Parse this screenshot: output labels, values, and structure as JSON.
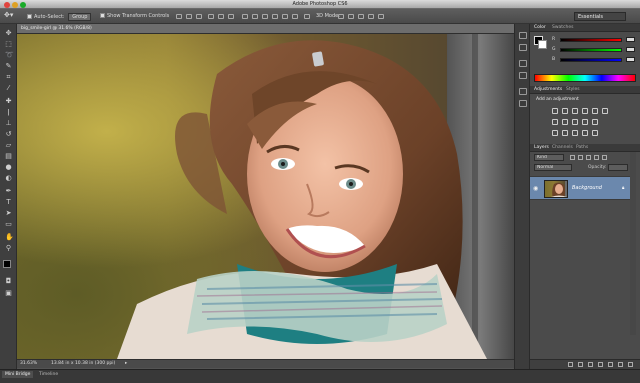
{
  "app": {
    "title": "Adobe Photoshop CS6"
  },
  "options_bar": {
    "auto_select_label": "Auto-Select:",
    "auto_select_value": "Group",
    "transform_controls_label": "Show Transform Controls",
    "mode_3d_label": "3D Mode:",
    "workspace": "Essentials"
  },
  "document": {
    "tab_label": "big_smile-girl @ 31.6% (RGB/8)",
    "zoom": "31.63%",
    "doc_info": "13.84 in x 10.38 in (300 ppi)"
  },
  "mini_bridge": {
    "tabs": [
      "Mini Bridge",
      "Timeline"
    ]
  },
  "color_panel": {
    "tabs": [
      "Color",
      "Swatches"
    ],
    "sliders": [
      {
        "label": "R",
        "value": "",
        "color_from": "#000000",
        "color_to": "#ff0000"
      },
      {
        "label": "G",
        "value": "",
        "color_from": "#000000",
        "color_to": "#00ff00"
      },
      {
        "label": "B",
        "value": "",
        "color_from": "#000000",
        "color_to": "#0000ff"
      }
    ]
  },
  "adjustments_panel": {
    "tabs": [
      "Adjustments",
      "Styles"
    ],
    "heading": "Add an adjustment"
  },
  "layers_panel": {
    "tabs": [
      "Layers",
      "Channels",
      "Paths"
    ],
    "kind_filter": "Kind",
    "blend_mode": "Normal",
    "opacity_label": "Opacity:",
    "opacity_value": "",
    "lock_label": "Lock:",
    "fill_label": "Fill:",
    "fill_value": "",
    "layers": [
      {
        "name": "Background",
        "selected": true,
        "locked": true
      }
    ]
  },
  "colors": {
    "selection": "#6b88ad",
    "panel_bg": "#4b4b4b",
    "toolbar_bg": "#3f3f3f"
  }
}
